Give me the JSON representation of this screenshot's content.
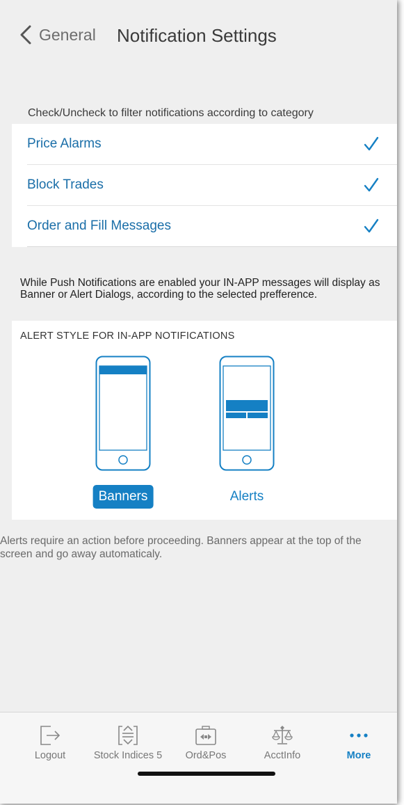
{
  "header": {
    "back_label": "General",
    "title": "Notification Settings"
  },
  "filter": {
    "hint": "Check/Uncheck to filter notifications according to category",
    "items": [
      {
        "label": "Price Alarms",
        "checked": true
      },
      {
        "label": "Block Trades",
        "checked": true
      },
      {
        "label": "Order and Fill Messages",
        "checked": true
      }
    ]
  },
  "push_description": "While Push Notifications are enabled your IN-APP messages will display as Banner or Alert Dialogs, according to the selected prefference.",
  "alert_style": {
    "heading": "ALERT STYLE FOR IN-APP NOTIFICATIONS",
    "options": [
      {
        "label": "Banners",
        "selected": true
      },
      {
        "label": "Alerts",
        "selected": false
      }
    ]
  },
  "alert_description": "Alerts require an action before proceeding. Banners appear at the top of the screen and go away automaticaly.",
  "tabbar": {
    "tabs": [
      {
        "label": "Logout",
        "icon": "logout-icon"
      },
      {
        "label": "Stock Indices 5",
        "icon": "stock-indices-icon"
      },
      {
        "label": "Ord&Pos",
        "icon": "orders-positions-icon"
      },
      {
        "label": "AcctInfo",
        "icon": "account-info-icon"
      },
      {
        "label": "More",
        "icon": "more-icon",
        "active": true
      }
    ]
  },
  "colors": {
    "accent": "#1580c4",
    "link": "#1a6ea8"
  }
}
